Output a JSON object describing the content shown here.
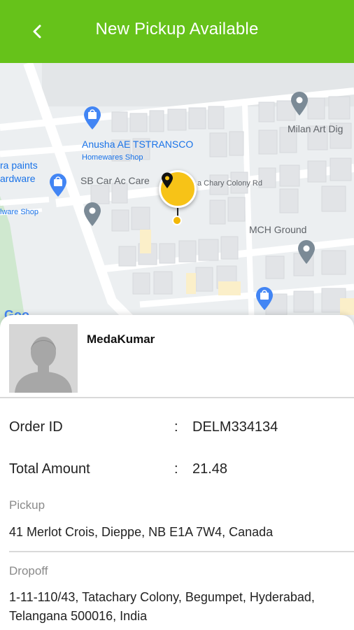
{
  "header": {
    "title": "New Pickup Available",
    "background_color": "#66c21a",
    "back_icon": "chevron-left-icon"
  },
  "map": {
    "labels": {
      "milan": "Milan Art Dig",
      "anusha": "Anusha AE TSTRANSCO",
      "homewares": "Homewares Shop",
      "ra_paints": "ra paints",
      "hardware": "ardware",
      "ware_shop": "lware Shop",
      "sb_car": "SB Car Ac Care",
      "chary_colony": "a Chary Colony Rd",
      "mch_ground": "MCH Ground",
      "google": "Goo"
    },
    "marker_color": "#f7c317"
  },
  "customer": {
    "name": "MedaKumar",
    "avatar_icon": "person-placeholder-icon"
  },
  "order": {
    "order_id_label": "Order ID",
    "order_id_value": "DELM334134",
    "total_label": "Total Amount",
    "total_value": "21.48",
    "separator": ":"
  },
  "pickup": {
    "label": "Pickup",
    "address": "41 Merlot Crois, Dieppe, NB E1A 7W4, Canada"
  },
  "dropoff": {
    "label": "Dropoff",
    "address": "1-11-110/43, Tatachary Colony, Begumpet, Hyderabad, Telangana 500016, India"
  }
}
